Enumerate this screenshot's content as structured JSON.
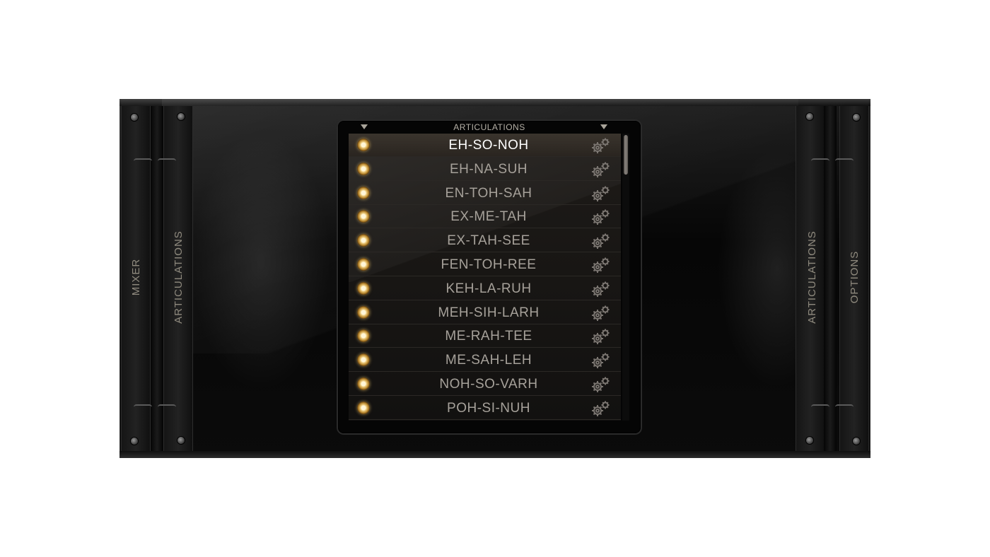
{
  "side_tabs": {
    "mixer": "MIXER",
    "articulations_left": "ARTICULATIONS",
    "articulations_right": "ARTICULATIONS",
    "options": "OPTIONS"
  },
  "list_header": {
    "title": "ARTICULATIONS"
  },
  "articulations": [
    {
      "name": "EH-SO-NOH",
      "selected": true
    },
    {
      "name": "EH-NA-SUH",
      "selected": false
    },
    {
      "name": "EN-TOH-SAH",
      "selected": false
    },
    {
      "name": "EX-ME-TAH",
      "selected": false
    },
    {
      "name": "EX-TAH-SEE",
      "selected": false
    },
    {
      "name": "FEN-TOH-REE",
      "selected": false
    },
    {
      "name": "KEH-LA-RUH",
      "selected": false
    },
    {
      "name": "MEH-SIH-LARH",
      "selected": false
    },
    {
      "name": "ME-RAH-TEE",
      "selected": false
    },
    {
      "name": "ME-SAH-LEH",
      "selected": false
    },
    {
      "name": "NOH-SO-VARH",
      "selected": false
    },
    {
      "name": "POH-SI-NUH",
      "selected": false
    }
  ],
  "colors": {
    "led": "#f3d48a",
    "selected_text": "#ffffff",
    "row_text": "#a6a19a",
    "tab_text": "#8f8a7e"
  },
  "icons": {
    "row_led": "led-indicator-icon",
    "row_settings": "gear-icon",
    "header_arrows": "dropdown-arrow-icon"
  }
}
